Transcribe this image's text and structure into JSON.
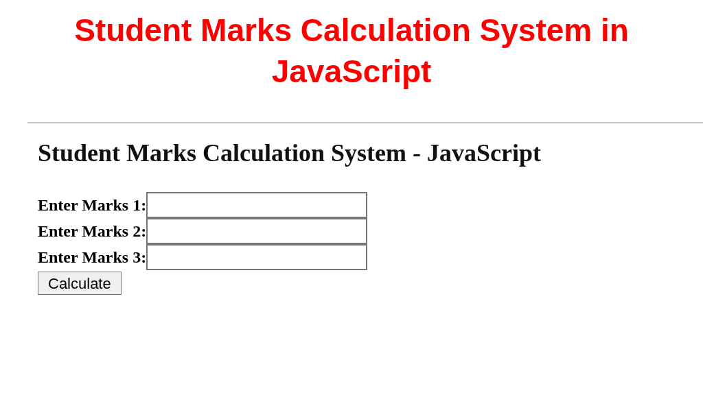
{
  "banner": {
    "title": "Student Marks Calculation System in JavaScript"
  },
  "page": {
    "heading": "Student Marks Calculation System - JavaScript",
    "fields": [
      {
        "label": "Enter Marks 1:"
      },
      {
        "label": "Enter Marks 2:"
      },
      {
        "label": "Enter Marks 3:"
      }
    ],
    "button": "Calculate"
  }
}
